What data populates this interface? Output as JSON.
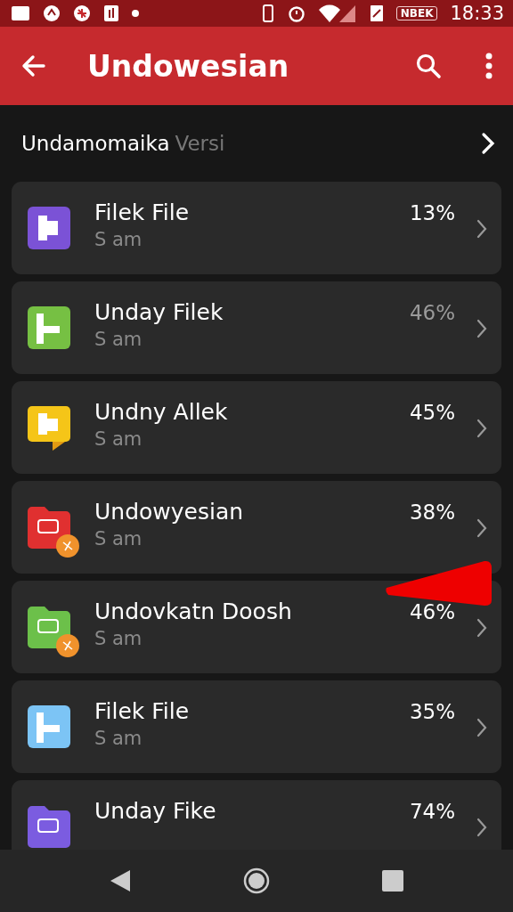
{
  "status_bar": {
    "badge": "NBEK",
    "time": "18:33"
  },
  "app_bar": {
    "title": "Undowesian"
  },
  "section": {
    "title": "Undamomaika",
    "subtitle": "Versi"
  },
  "files": [
    {
      "kind": "document",
      "color": "#7b52d6",
      "name": "Filek File",
      "time": "S am",
      "percent": "13%",
      "dimmed": false,
      "badge": false
    },
    {
      "kind": "flag",
      "color": "#76c043",
      "name": "Unday Filek",
      "time": "S am",
      "percent": "46%",
      "dimmed": true,
      "badge": false
    },
    {
      "kind": "chat",
      "color": "#f5c518",
      "name": "Undny Allek",
      "time": "S am",
      "percent": "45%",
      "dimmed": false,
      "badge": false
    },
    {
      "kind": "folder",
      "color": "#e03030",
      "name": "Undowyesian",
      "time": "S am",
      "percent": "38%",
      "dimmed": false,
      "badge": true
    },
    {
      "kind": "folder",
      "color": "#6cc04a",
      "name": "Undovkatn Doosh",
      "time": "S am",
      "percent": "46%",
      "dimmed": false,
      "badge": true
    },
    {
      "kind": "flag",
      "color": "#7cc4f5",
      "name": "Filek File",
      "time": "S am",
      "percent": "35%",
      "dimmed": false,
      "badge": false
    },
    {
      "kind": "folder",
      "color": "#7b5ce0",
      "name": "Unday Fike",
      "percent": "74%",
      "dimmed": false,
      "badge": false
    }
  ]
}
